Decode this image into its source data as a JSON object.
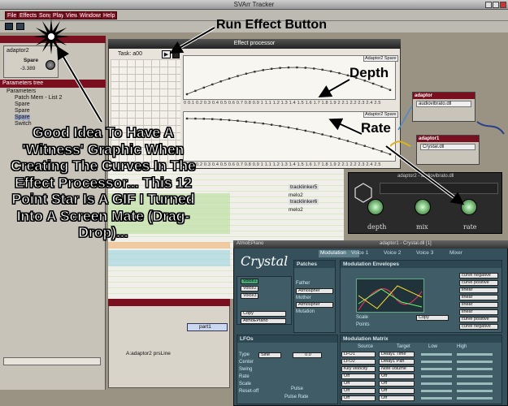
{
  "app": {
    "title": "SVArr Tracker"
  },
  "menu": [
    "File",
    "Effects",
    "Song",
    "Play",
    "View",
    "Windows",
    "Help"
  ],
  "left_panel": {
    "adaptor_tab": "adaptor2",
    "spare_label": "Spare",
    "spare_value": "-3.389",
    "tree_title": "Parameters tree",
    "root": "Parameters",
    "items": [
      "Patch Mem - List 2",
      "Spare",
      "Spare",
      "Spare",
      "Switch"
    ]
  },
  "effect_processor": {
    "title": "Effect processor",
    "task": "Task: a00",
    "depth_badge": "Adaptor2 Spare",
    "rate_badge": "Adaptor2 Spare",
    "ticks": "0 0.1 0.2 0.3 0.4 0.5 0.6 0.7 0.8 0.9 1 1.1 1.2 1.3 1.4 1.5 1.6 1.7 1.8 1.9 2 2.1 2.2 2.3 2.4 2.5"
  },
  "annotations": {
    "run_effect": "Run Effect Button",
    "depth": "Depth",
    "rate": "Rate",
    "caption": "Good Idea To Have A 'Witness' Graphic When Creating The Curves In The Effect Processor... This 12 Point Star Is A GIF I Turned Into A Screen Mate (Drag-Drop)..."
  },
  "tracks": [
    "tracklinker5",
    "melo2",
    "tracklinker6",
    "melo2"
  ],
  "sequencer": {
    "part": "part1",
    "line": "A:adaptor2 prsLine"
  },
  "knob_window": {
    "title": "adaptor2 - audiovibrato.dll",
    "knobs": [
      "depth",
      "mix",
      "rate"
    ]
  },
  "nodes": [
    {
      "title": "adaptor",
      "dll": "audiovibrato.dll"
    },
    {
      "title": "adaptor1",
      "dll": "Crystal.dll"
    }
  ],
  "crystal": {
    "title": "adaptor1 - Crystal.dll [1]",
    "preset": "AtmoEPiano",
    "tabs": [
      "Modulation",
      "Voice 1",
      "Voice 2",
      "Voice 3",
      "Mixer"
    ],
    "patches": "Patches",
    "father": "Father",
    "mother": "Mother",
    "father_val": "Atmospher",
    "mother_val": "Atmospher",
    "mutation": "Mutation",
    "mod_env": "Modulation Envelopes",
    "scale": "Scale",
    "points": "Points",
    "copy": "Copy",
    "lfos": "LFOs",
    "matrix": "Modulation Matrix",
    "source": "Source",
    "target": "Target",
    "low": "Low",
    "high": "High",
    "env_list": [
      "curve negative",
      "curve positive",
      "linear",
      "linear",
      "linear",
      "linear",
      "curve positive",
      "curve negative"
    ],
    "lfo_rows": [
      "Type",
      "Center",
      "Swing",
      "Rate",
      "Scale",
      "Reset-off"
    ],
    "lfo_type": "Sine",
    "lfo_value": "0.0",
    "matrix_sources": [
      "LFO1",
      "LFO2",
      "Key velocity",
      "Off",
      "Off",
      "Off",
      "Off"
    ],
    "matrix_targets": [
      "Delay1 Time",
      "Delay1 Pan",
      "Note volume",
      "Off",
      "Off",
      "Off",
      "Off"
    ],
    "voices": [
      "Voice1",
      "Voice2",
      "Voice3"
    ],
    "pulse": "Pulse",
    "pulse_rate": "Pulse Rate",
    "scale_val": "9",
    "points_val": "9"
  },
  "colors": {
    "maroon": "#7a0f20",
    "panel": "#c8c3b8",
    "crystal_bg": "#35505a"
  }
}
